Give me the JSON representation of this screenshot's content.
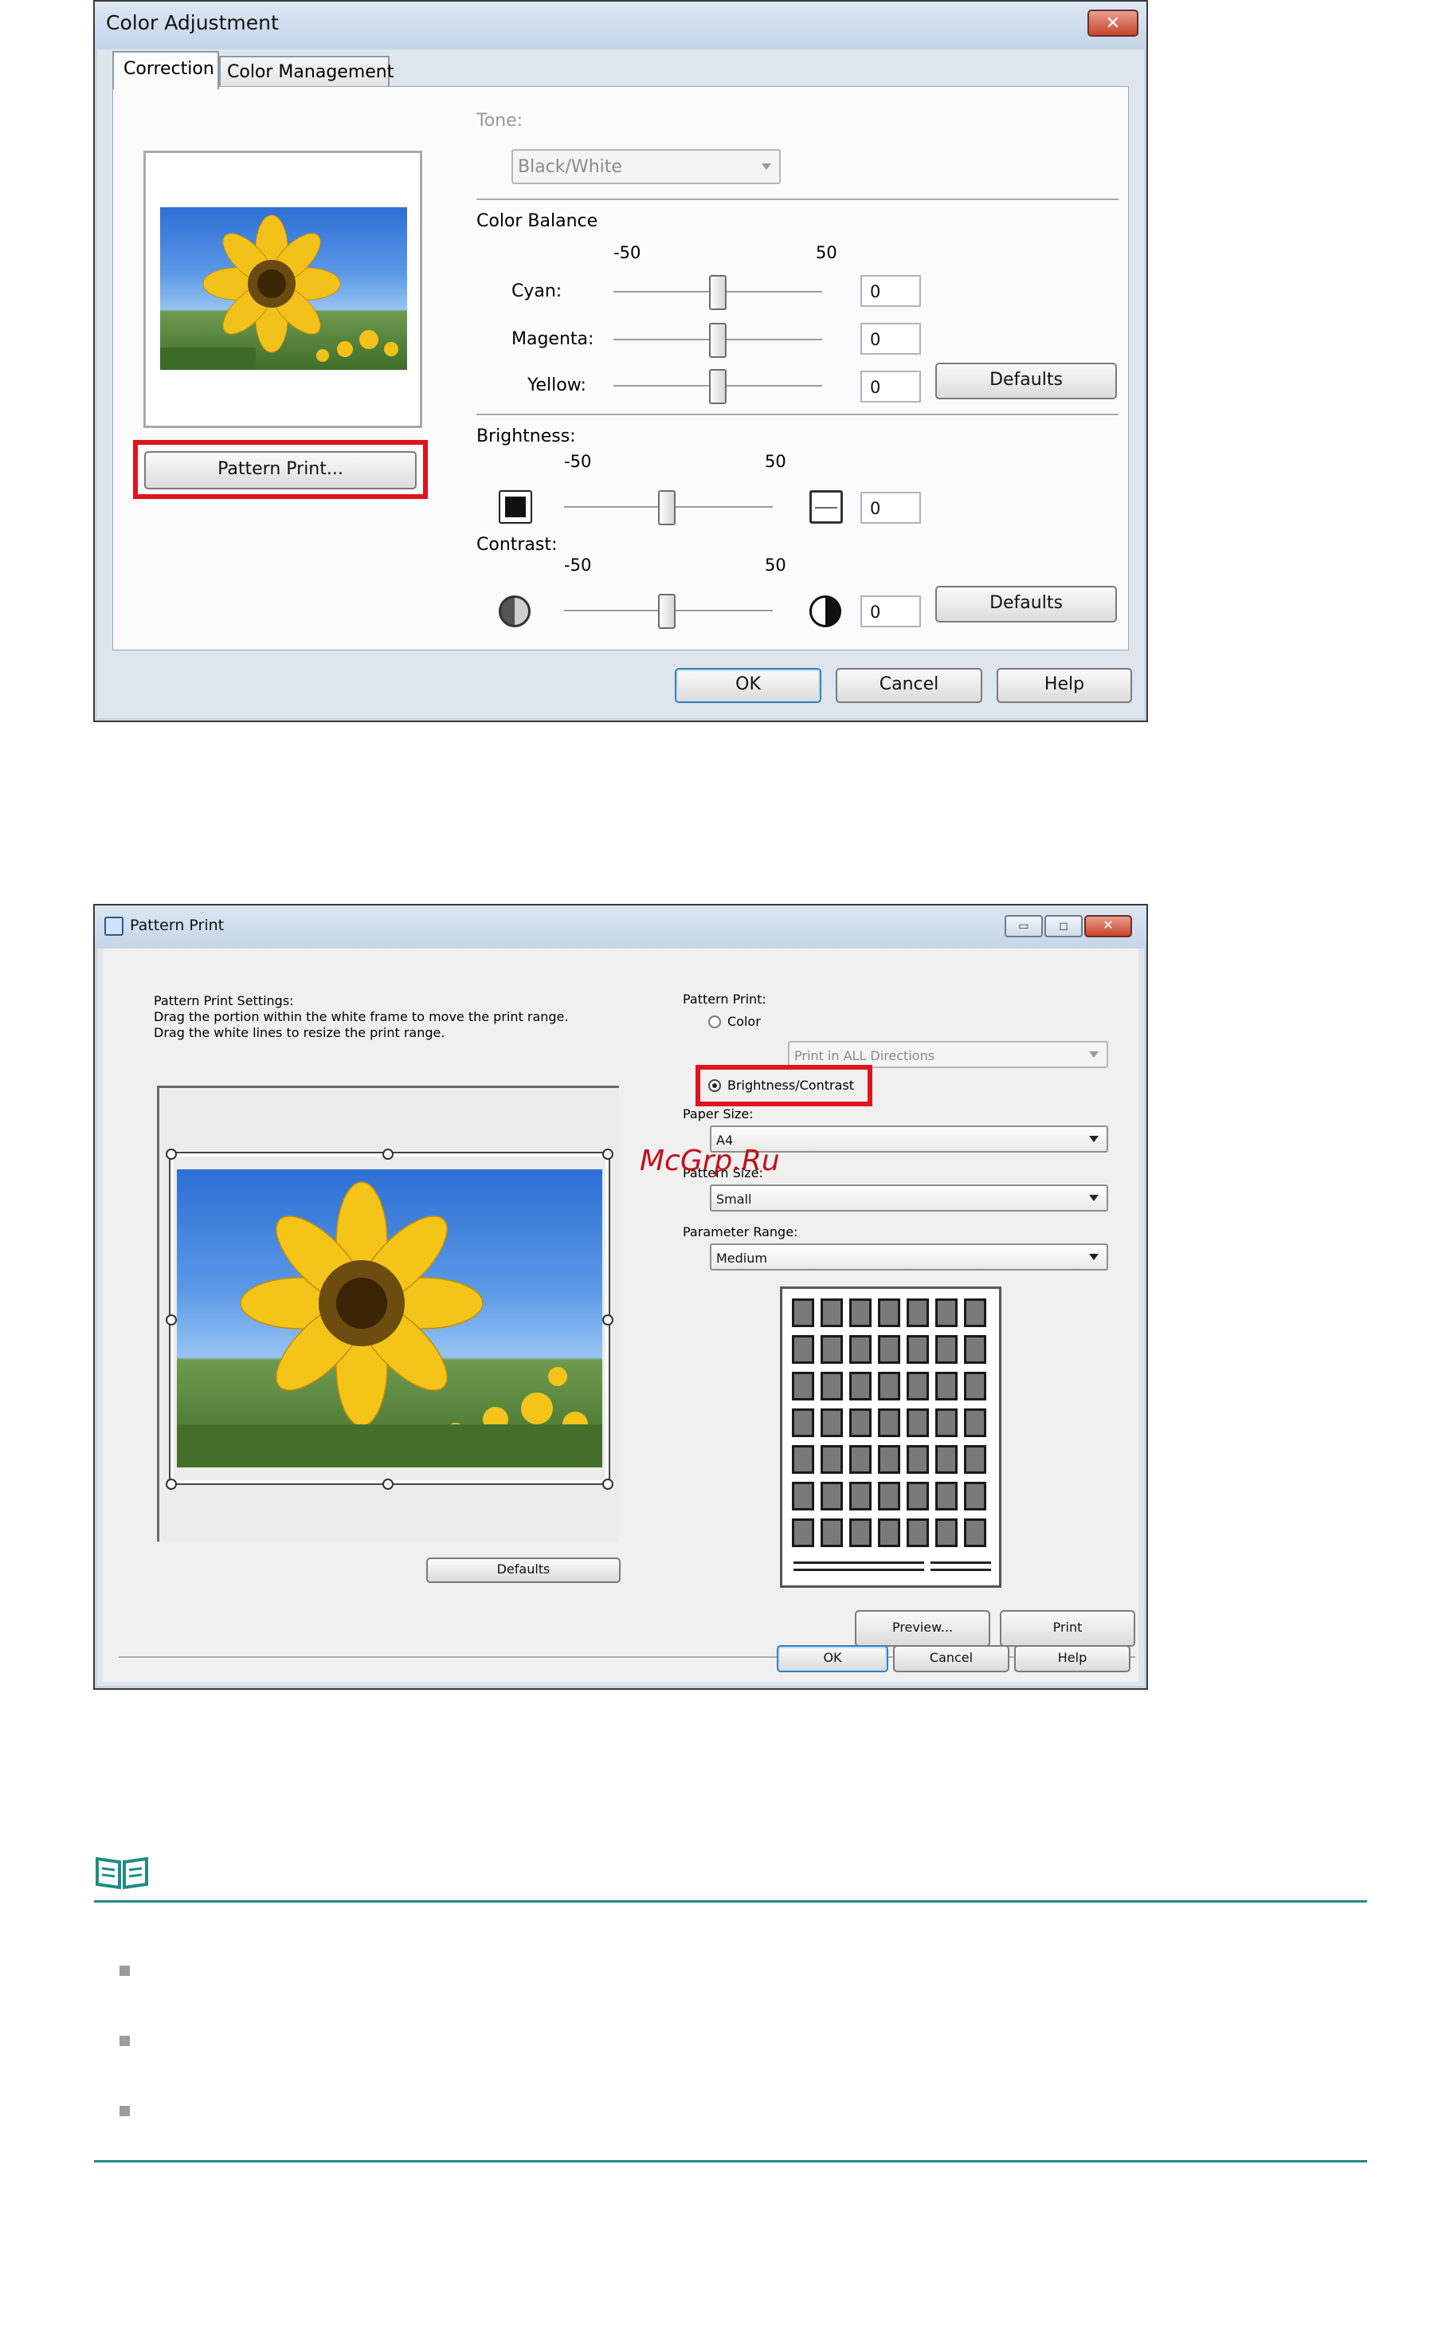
{
  "color_adjustment": {
    "title": "Color Adjustment",
    "close_glyph": "✕",
    "tabs": [
      {
        "label": "Correction",
        "active": true
      },
      {
        "label": "Color Management",
        "active": false
      }
    ],
    "tone": {
      "label": "Tone:",
      "value": "Black/White",
      "disabled": true
    },
    "color_balance": {
      "title": "Color Balance",
      "min_label": "-50",
      "max_label": "50",
      "sliders": [
        {
          "label": "Cyan:",
          "value": "0"
        },
        {
          "label": "Magenta:",
          "value": "0"
        },
        {
          "label": "Yellow:",
          "value": "0"
        }
      ],
      "defaults_label": "Defaults"
    },
    "brightness": {
      "label": "Brightness:",
      "min_label": "-50",
      "max_label": "50",
      "value": "0"
    },
    "contrast": {
      "label": "Contrast:",
      "min_label": "-50",
      "max_label": "50",
      "value": "0",
      "defaults_label": "Defaults"
    },
    "pattern_print_button": "Pattern Print...",
    "buttons": {
      "ok": "OK",
      "cancel": "Cancel",
      "help": "Help"
    },
    "icons": {
      "close": "close-icon",
      "brightness_low": "brightness-low-icon",
      "brightness_high": "brightness-high-icon",
      "contrast_low": "contrast-low-icon",
      "contrast_high": "contrast-high-icon"
    },
    "highlight_color": "#e0141e"
  },
  "pattern_print": {
    "title": "Pattern Print",
    "window_controls": {
      "minimize": "▭",
      "maximize": "◻",
      "close": "✕"
    },
    "settings_heading": "Pattern Print Settings:",
    "instructions": [
      "Drag the portion within the white frame to move the print range.",
      "Drag the white lines to resize the print range."
    ],
    "pattern_print_label": "Pattern Print:",
    "options": [
      {
        "label": "Color",
        "selected": false
      },
      {
        "label": "Brightness/Contrast",
        "selected": true
      }
    ],
    "direction_value": "Print in ALL Directions",
    "paper_size": {
      "label": "Paper Size:",
      "value": "A4"
    },
    "pattern_size": {
      "label": "Pattern Size:",
      "value": "Small"
    },
    "parameter_range": {
      "label": "Parameter Range:",
      "value": "Medium"
    },
    "grid": {
      "rows": 7,
      "cols": 7
    },
    "defaults_label": "Defaults",
    "preview_label": "Preview...",
    "print_label": "Print",
    "buttons": {
      "ok": "OK",
      "cancel": "Cancel",
      "help": "Help"
    },
    "watermark": "McGrp.Ru"
  },
  "note": {
    "icon": "book-note-icon",
    "accent_color": "#1f8c84",
    "items": [
      "",
      "",
      ""
    ]
  }
}
